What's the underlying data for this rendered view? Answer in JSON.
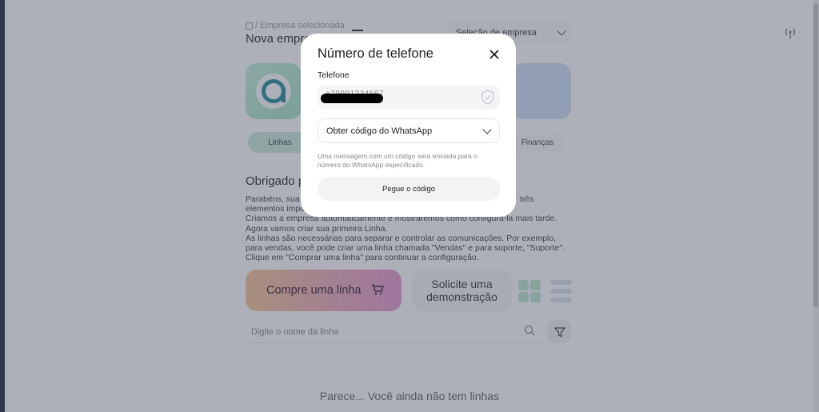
{
  "header": {
    "breadcrumb": "/ Empresa selecionada",
    "title": "Nova empresa",
    "company_select": "Seleção de empresa"
  },
  "tabs": {
    "lines": "Linhas",
    "finance": "Finanças"
  },
  "welcome": {
    "title": "Obrigado p",
    "line1": "Parabéns, sua",
    "line1_end": "três",
    "line2": "elementos impo",
    "line3": "Criamos a empresa automaticamente e mostraremos como configurá-la mais tarde.",
    "line4": "Agora vamos criar sua primeira Linha.",
    "line5": "As linhas são necessárias para separar e controlar as comunicações. Por exemplo,",
    "line6": "para vendas, você pode criar uma linha chamada \"Vendas\" e para suporte, \"Suporte\".",
    "line7": "Clique em \"Comprar uma linha\" para continuar a configuração."
  },
  "actions": {
    "buy_line": "Compre uma linha",
    "demo_line1": "Solicite uma",
    "demo_line2": "demonstração"
  },
  "search": {
    "placeholder": "Digite o nome da linha"
  },
  "empty_state": "Parece... Você ainda não tem linhas",
  "modal": {
    "title": "Número de telefone",
    "phone_label": "Telefone",
    "phone_value": "+79991234567",
    "method": "Obter código do WhatsApp",
    "hint": "Uma mensagem com um código será enviada para o número do WhatsApp especificado.",
    "submit": "Pegue o código"
  },
  "colors": {
    "overlay": "#3c4256",
    "accent_green": "#2f8f9d",
    "buy_gradient_start": "#f8c69c",
    "buy_gradient_end": "#e79bd3"
  }
}
